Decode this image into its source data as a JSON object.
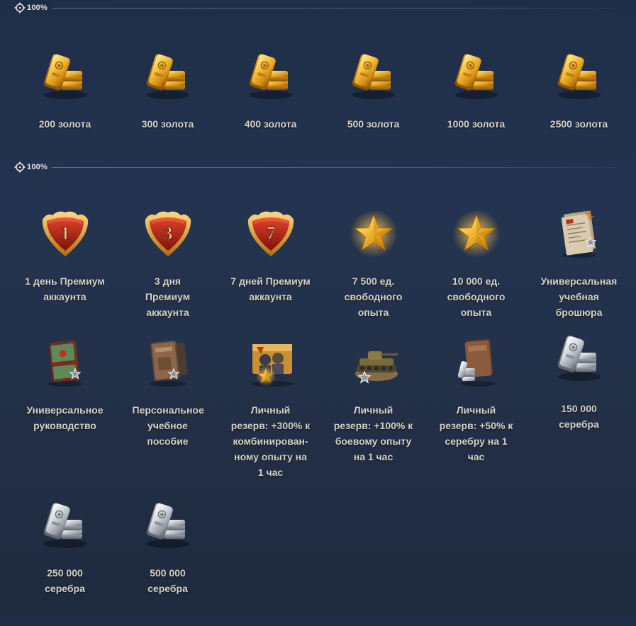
{
  "sections": [
    {
      "percent": "100%",
      "icon": "crosshair-icon"
    },
    {
      "percent": "100%",
      "icon": "crosshair-icon"
    }
  ],
  "gold_items": [
    {
      "label": "200 золота",
      "icon": "gold-bars-icon"
    },
    {
      "label": "300 золота",
      "icon": "gold-bars-icon"
    },
    {
      "label": "400 золота",
      "icon": "gold-bars-icon"
    },
    {
      "label": "500 золота",
      "icon": "gold-bars-icon"
    },
    {
      "label": "1000 золота",
      "icon": "gold-bars-icon"
    },
    {
      "label": "2500 золота",
      "icon": "gold-bars-icon"
    }
  ],
  "reward_items": [
    {
      "label": "1 день Премиум аккаунта",
      "icon": "premium-1-day-shield-icon",
      "badge": "1"
    },
    {
      "label": "3 дня Премиум аккаунта",
      "icon": "premium-3-days-shield-icon",
      "badge": "3"
    },
    {
      "label": "7 дней Премиум аккаунта",
      "icon": "premium-7-days-shield-icon",
      "badge": "7"
    },
    {
      "label": "7 500 ед. свободного опыта",
      "icon": "free-xp-star-icon"
    },
    {
      "label": "10 000 ед. свободного опыта",
      "icon": "free-xp-star-icon"
    },
    {
      "label": "Универсальная учебная брошюра",
      "icon": "training-brochure-icon"
    },
    {
      "label": "Универсальное руководство",
      "icon": "training-guide-icon"
    },
    {
      "label": "Персональное учебное пособие",
      "icon": "personal-training-manual-icon"
    },
    {
      "label": "Личный резерв: +300% к комбинирован-ному опыту на 1 час",
      "icon": "crew-xp-reserve-icon"
    },
    {
      "label": "Личный резерв: +100% к боевому опыту на 1 час",
      "icon": "battle-xp-reserve-tank-icon"
    },
    {
      "label": "Личный резерв: +50% к серебру на 1 час",
      "icon": "credits-reserve-icon"
    },
    {
      "label": "150 000 серебра",
      "icon": "silver-bars-icon"
    },
    {
      "label": "250 000 серебра",
      "icon": "silver-bars-icon"
    },
    {
      "label": "500 000 серебра",
      "icon": "silver-bars-icon"
    }
  ],
  "colors": {
    "background_top": "#1f2d47",
    "label": "#d6d2c6",
    "gold": "#f2b531",
    "premium_red": "#b8261a",
    "silver": "#c9ccd2"
  }
}
